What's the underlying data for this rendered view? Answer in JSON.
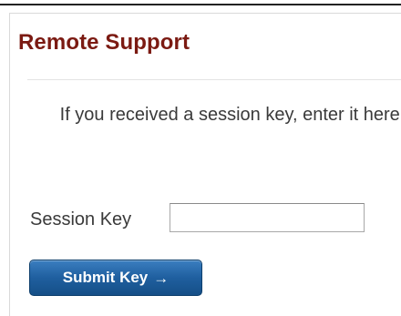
{
  "panel": {
    "title": "Remote Support",
    "instructions": "If you received a session key, enter it here."
  },
  "form": {
    "session_key_label": "Session Key",
    "session_key_value": "",
    "session_key_placeholder": "",
    "submit_label": "Submit Key",
    "submit_icon": "arrow-right-icon"
  },
  "colors": {
    "title": "#7b1a12",
    "button": "#1f5f9f"
  }
}
